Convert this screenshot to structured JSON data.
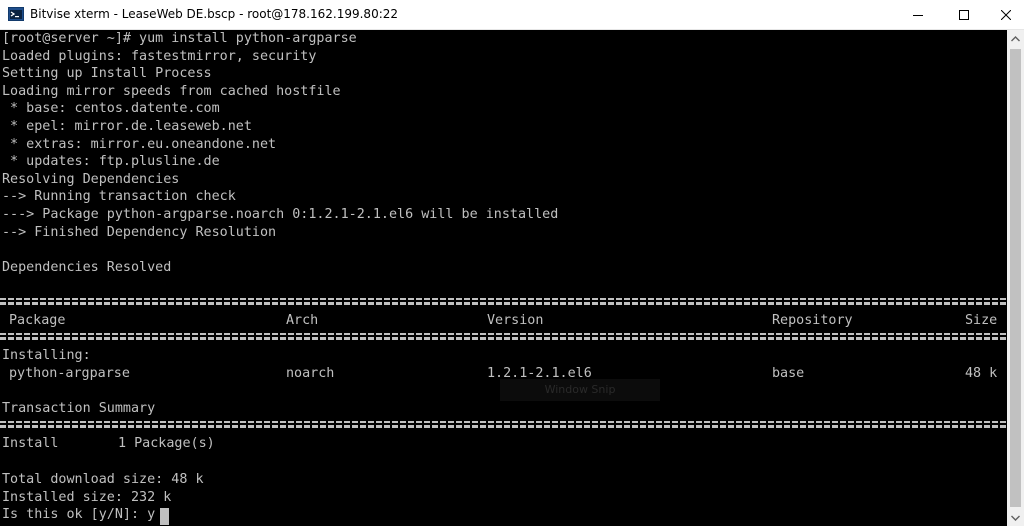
{
  "window": {
    "title": "Bitvise xterm - LeaseWeb DE.bscp - root@178.162.199.80:22",
    "app_icon": "terminal-app-icon",
    "controls": {
      "minimize": "minimize-icon",
      "maximize": "maximize-icon",
      "close": "close-icon"
    }
  },
  "terminal": {
    "lines": [
      "[root@server ~]# yum install python-argparse",
      "Loaded plugins: fastestmirror, security",
      "Setting up Install Process",
      "Loading mirror speeds from cached hostfile",
      " * base: centos.datente.com",
      " * epel: mirror.de.leaseweb.net",
      " * extras: mirror.eu.oneandone.net",
      " * updates: ftp.plusline.de",
      "Resolving Dependencies",
      "--> Running transaction check",
      "---> Package python-argparse.noarch 0:1.2.1-2.1.el6 will be installed",
      "--> Finished Dependency Resolution",
      "Dependencies Resolved"
    ],
    "table": {
      "headers": {
        "package": "Package",
        "arch": "Arch",
        "version": "Version",
        "repository": "Repository",
        "size": "Size"
      },
      "section": "Installing:",
      "row": {
        "package": "python-argparse",
        "arch": "noarch",
        "version": "1.2.1-2.1.el6",
        "repository": "base",
        "size": "48 k"
      }
    },
    "summary": {
      "title": "Transaction Summary",
      "install_label": "Install",
      "install_count": "1 Package(s)"
    },
    "footer": [
      "Total download size: 48 k",
      "Installed size: 232 k"
    ],
    "prompt": "Is this ok [y/N]: y",
    "ghost_text": "Window Snip"
  },
  "colors": {
    "terminal_bg": "#000000",
    "terminal_fg": "#c0c0c0"
  }
}
